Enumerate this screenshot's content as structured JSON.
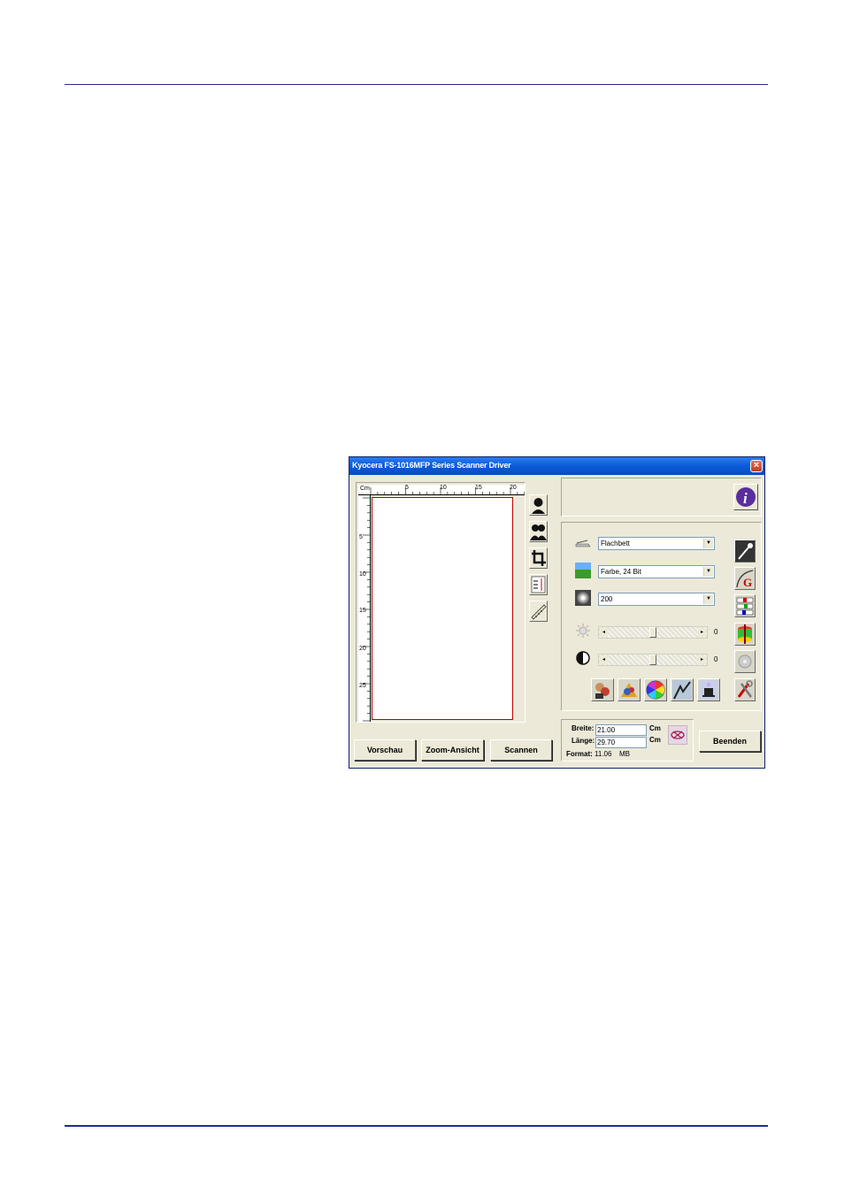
{
  "window": {
    "title": "Kyocera FS-1016MFP Series Scanner Driver",
    "close_glyph": "×"
  },
  "ruler": {
    "unit": "Cm",
    "top_ticks": [
      "5",
      "10",
      "15",
      "20"
    ],
    "left_ticks": [
      "5",
      "10",
      "15",
      "20",
      "25"
    ]
  },
  "left_tools": [
    {
      "name": "single-person-icon"
    },
    {
      "name": "two-persons-icon"
    },
    {
      "name": "crop-icon"
    },
    {
      "name": "text-size-icon"
    },
    {
      "name": "measure-ruler-icon"
    }
  ],
  "buttons": {
    "preview": "Vorschau",
    "zoom": "Zoom-Ansicht",
    "scan": "Scannen",
    "quit": "Beenden"
  },
  "settings": {
    "source": "Flachbett",
    "color_mode": "Farbe, 24 Bit",
    "resolution": "200",
    "brightness": "0",
    "contrast": "0"
  },
  "size": {
    "width_label": "Breite:",
    "width_value": "21.00",
    "width_unit": "Cm",
    "length_label": "Länge:",
    "length_value": "29.70",
    "length_unit": "Cm",
    "format_label": "Format:",
    "format_value": "11.06",
    "format_unit": "MB"
  },
  "colors": {
    "titlebar": "#0a5ad8",
    "window_bg": "#ece9d8",
    "page_border": "#c00000",
    "rule_line": "#1f2a9e"
  }
}
